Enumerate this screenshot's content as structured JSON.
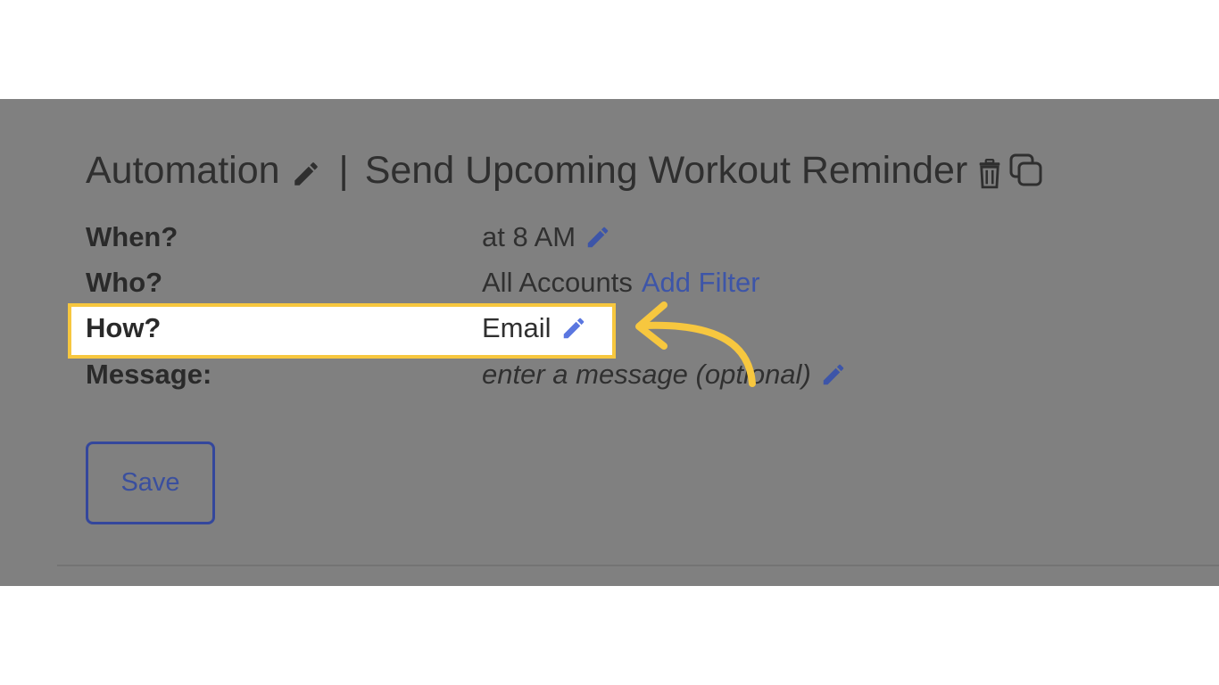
{
  "automation": {
    "label": "Automation",
    "separator": "|",
    "name": "Send Upcoming Workout Reminder"
  },
  "fields": {
    "when": {
      "label": "When?",
      "value": "at 8 AM"
    },
    "who": {
      "label": "Who?",
      "value": "All Accounts",
      "link": "Add Filter"
    },
    "how": {
      "label": "How?",
      "value": "Email"
    },
    "message": {
      "label": "Message:",
      "placeholder": "enter a message (optional)"
    }
  },
  "actions": {
    "save_label": "Save"
  },
  "icons": {
    "title_edit": "pencil-icon",
    "delete": "trash-icon",
    "copy": "copy-icon",
    "field_edit": "pencil-icon",
    "annotation": "curved-arrow-icon"
  },
  "colors": {
    "overlay": "#808080",
    "accent_blue": "#3d55a8",
    "highlight": "#f7c73f",
    "text_dark": "#2f2f2f"
  }
}
